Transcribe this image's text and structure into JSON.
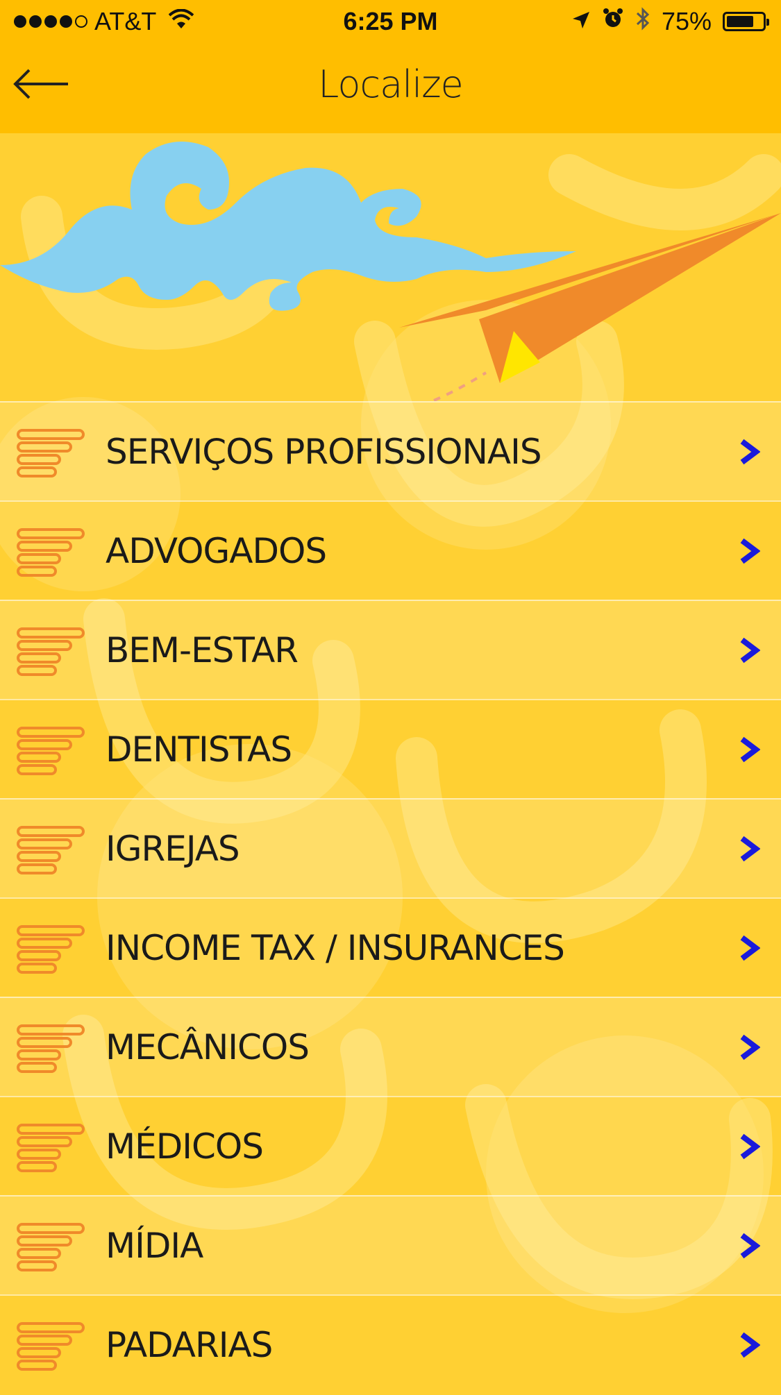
{
  "status_bar": {
    "carrier": "AT&T",
    "signal_bars_filled": 4,
    "signal_bars_total": 5,
    "time": "6:25 PM",
    "battery_percent": "75%",
    "battery_level": 0.75,
    "icons": [
      "wifi-icon",
      "location-arrow-icon",
      "alarm-icon",
      "bluetooth-icon",
      "battery-icon"
    ]
  },
  "nav": {
    "title": "Localize",
    "back_icon": "arrow-left-icon"
  },
  "colors": {
    "bar": "#ffbe00",
    "background": "#ffd033",
    "accent_orange": "#f08a2a",
    "chevron_blue": "#1a1adb",
    "cloud_blue": "#87d0f0"
  },
  "categories": [
    {
      "label": "SERVIÇOS PROFISSIONAIS"
    },
    {
      "label": "ADVOGADOS"
    },
    {
      "label": "BEM-ESTAR"
    },
    {
      "label": "DENTISTAS"
    },
    {
      "label": "IGREJAS"
    },
    {
      "label": "INCOME TAX / INSURANCES"
    },
    {
      "label": "MECÂNICOS"
    },
    {
      "label": "MÉDICOS"
    },
    {
      "label": "MÍDIA"
    },
    {
      "label": "PADARIAS"
    }
  ]
}
